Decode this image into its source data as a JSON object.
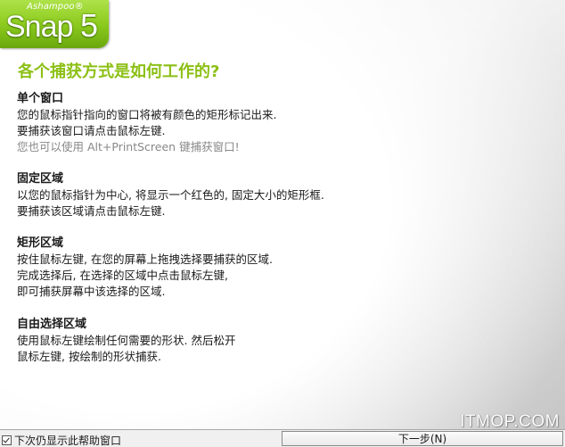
{
  "logo": {
    "brand": "Ashampoo®",
    "name": "Snap",
    "version": "5"
  },
  "main_title": "各个捕获方式是如何工作的?",
  "sections": [
    {
      "title": "单个窗口",
      "lines": [
        "您的鼠标指针指向的窗口将被有颜色的矩形标记出来.",
        "要捕获该窗口请点击鼠标左键."
      ],
      "hint": "您也可以使用 Alt+PrintScreen 键捕获窗口!"
    },
    {
      "title": "固定区域",
      "lines": [
        "以您的鼠标指针为中心, 将显示一个红色的, 固定大小的矩形框.",
        "要捕获该区域请点击鼠标左键."
      ]
    },
    {
      "title": "矩形区域",
      "lines": [
        "按住鼠标左键, 在您的屏幕上拖拽选择要捕获的区域.",
        "完成选择后, 在选择的区域中点击鼠标左键,",
        "即可捕获屏幕中该选择的区域."
      ]
    },
    {
      "title": "自由选择区域",
      "lines": [
        "使用鼠标左键绘制任何需要的形状. 然后松开",
        "鼠标左键, 按绘制的形状捕获."
      ]
    }
  ],
  "footer": {
    "checkbox_label": "下次仍显示此帮助窗口",
    "checkbox_checked": true,
    "next_button_label": "下一步(N)"
  },
  "watermark": "ITMOP.COM",
  "colors": {
    "accent_green": "#8cc015",
    "logo_green": "#8ccb1e",
    "hint_gray": "#888888"
  }
}
